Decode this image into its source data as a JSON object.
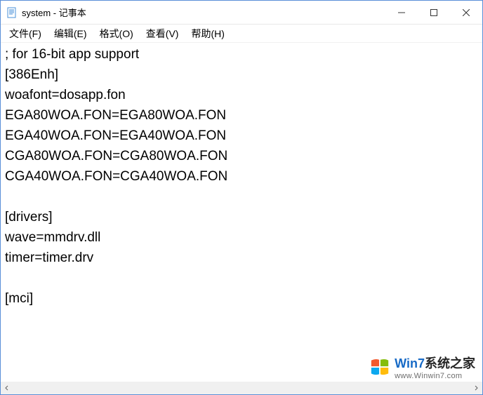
{
  "titlebar": {
    "icon": "notepad-icon",
    "title": "system - 记事本"
  },
  "menu": {
    "file": "文件(F)",
    "edit": "编辑(E)",
    "format": "格式(O)",
    "view": "查看(V)",
    "help": "帮助(H)"
  },
  "editor": {
    "content": "; for 16-bit app support\n[386Enh]\nwoafont=dosapp.fon\nEGA80WOA.FON=EGA80WOA.FON\nEGA40WOA.FON=EGA40WOA.FON\nCGA80WOA.FON=CGA80WOA.FON\nCGA40WOA.FON=CGA40WOA.FON\n\n[drivers]\nwave=mmdrv.dll\ntimer=timer.drv\n\n[mci]"
  },
  "watermark": {
    "brand_prefix": "Win7",
    "brand_suffix": "系统之家",
    "url": "www.Winwin7.com"
  }
}
